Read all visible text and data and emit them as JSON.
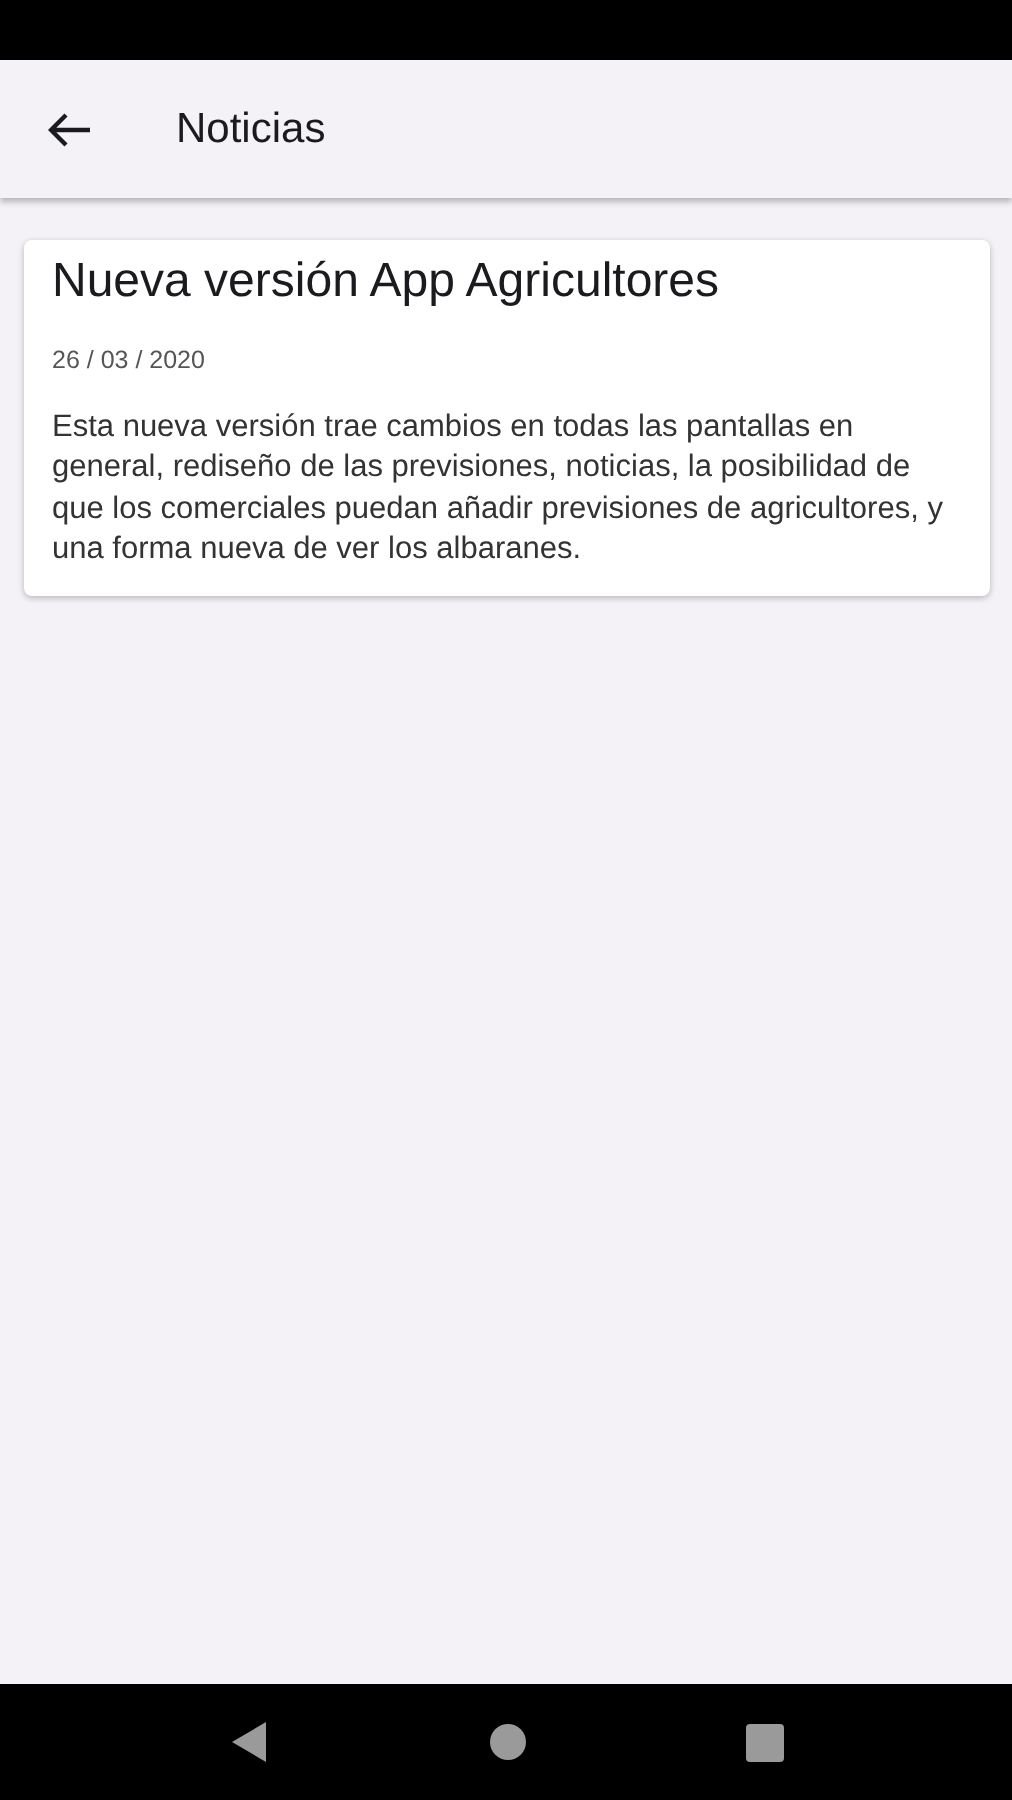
{
  "app_bar": {
    "title": "Noticias"
  },
  "news": [
    {
      "title": "Nueva versión App Agricultores",
      "date": "26 / 03 / 2020",
      "body": "Esta nueva versión trae cambios en todas las pantallas en general, rediseño de las previsiones, noticias, la posibilidad de que los comerciales puedan añadir previsiones de agricultores, y una forma nueva de ver los albaranes."
    }
  ]
}
